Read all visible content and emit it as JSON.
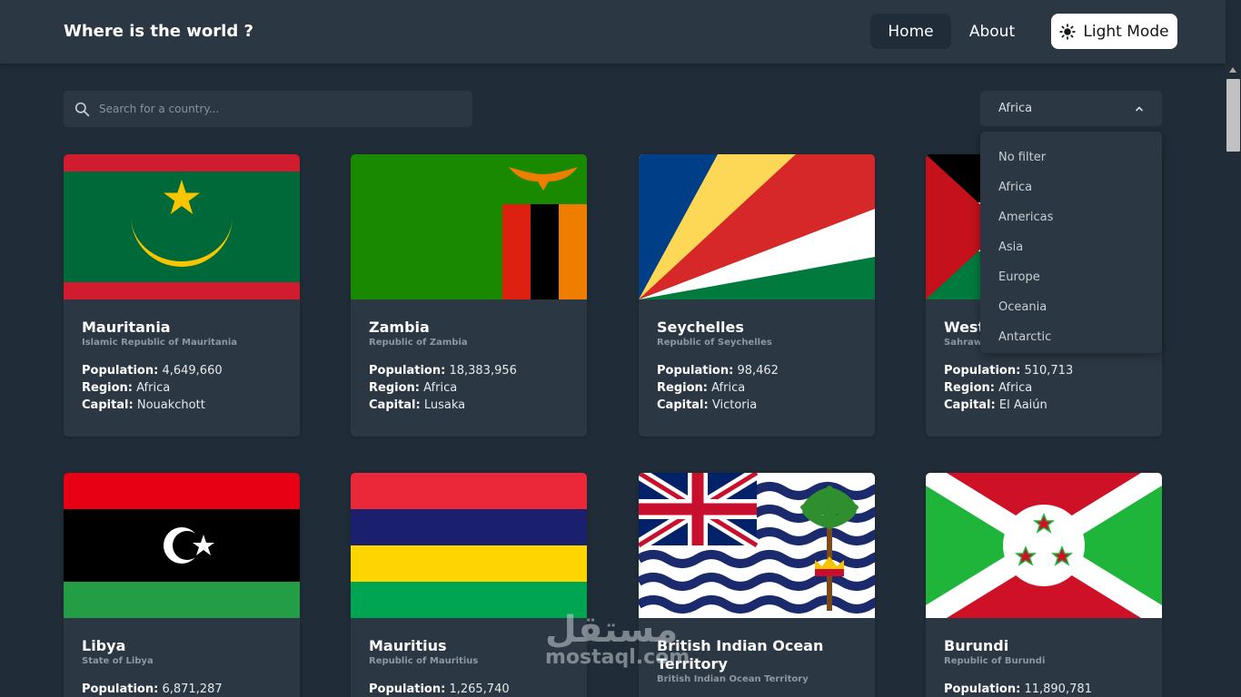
{
  "header": {
    "title": "Where is the world ?",
    "nav": {
      "home": "Home",
      "about": "About",
      "theme_toggle": "Light Mode"
    }
  },
  "search": {
    "placeholder": "Search for a country...",
    "value": ""
  },
  "filter": {
    "selected": "Africa",
    "options": [
      "No filter",
      "Africa",
      "Americas",
      "Asia",
      "Europe",
      "Oceania",
      "Antarctic"
    ]
  },
  "labels": {
    "population": "Population:",
    "region": "Region:",
    "capital": "Capital:"
  },
  "countries": [
    {
      "name": "Mauritania",
      "official": "Islamic Republic of Mauritania",
      "population": "4,649,660",
      "region": "Africa",
      "capital": "Nouakchott",
      "flag": "mauritania-flag"
    },
    {
      "name": "Zambia",
      "official": "Republic of Zambia",
      "population": "18,383,956",
      "region": "Africa",
      "capital": "Lusaka",
      "flag": "zambia-flag"
    },
    {
      "name": "Seychelles",
      "official": "Republic of Seychelles",
      "population": "98,462",
      "region": "Africa",
      "capital": "Victoria",
      "flag": "seychelles-flag"
    },
    {
      "name": "West",
      "official": "Sahraw",
      "population": "510,713",
      "region": "Africa",
      "capital": "El Aaiún",
      "flag": "western-sahara-flag"
    },
    {
      "name": "Libya",
      "official": "State of Libya",
      "population": "6,871,287",
      "flag": "libya-flag"
    },
    {
      "name": "Mauritius",
      "official": "Republic of Mauritius",
      "population": "1,265,740",
      "flag": "mauritius-flag"
    },
    {
      "name": "British Indian Ocean Territory",
      "official": "British Indian Ocean Territory",
      "flag": "biot-flag"
    },
    {
      "name": "Burundi",
      "official": "Republic of Burundi",
      "population": "11,890,781",
      "flag": "burundi-flag"
    }
  ],
  "watermark": {
    "arabic": "مستقل",
    "latin": "mostaql.com"
  },
  "colors": {
    "background": "#202c37",
    "element": "#2b3743",
    "text": "#ffffff"
  }
}
